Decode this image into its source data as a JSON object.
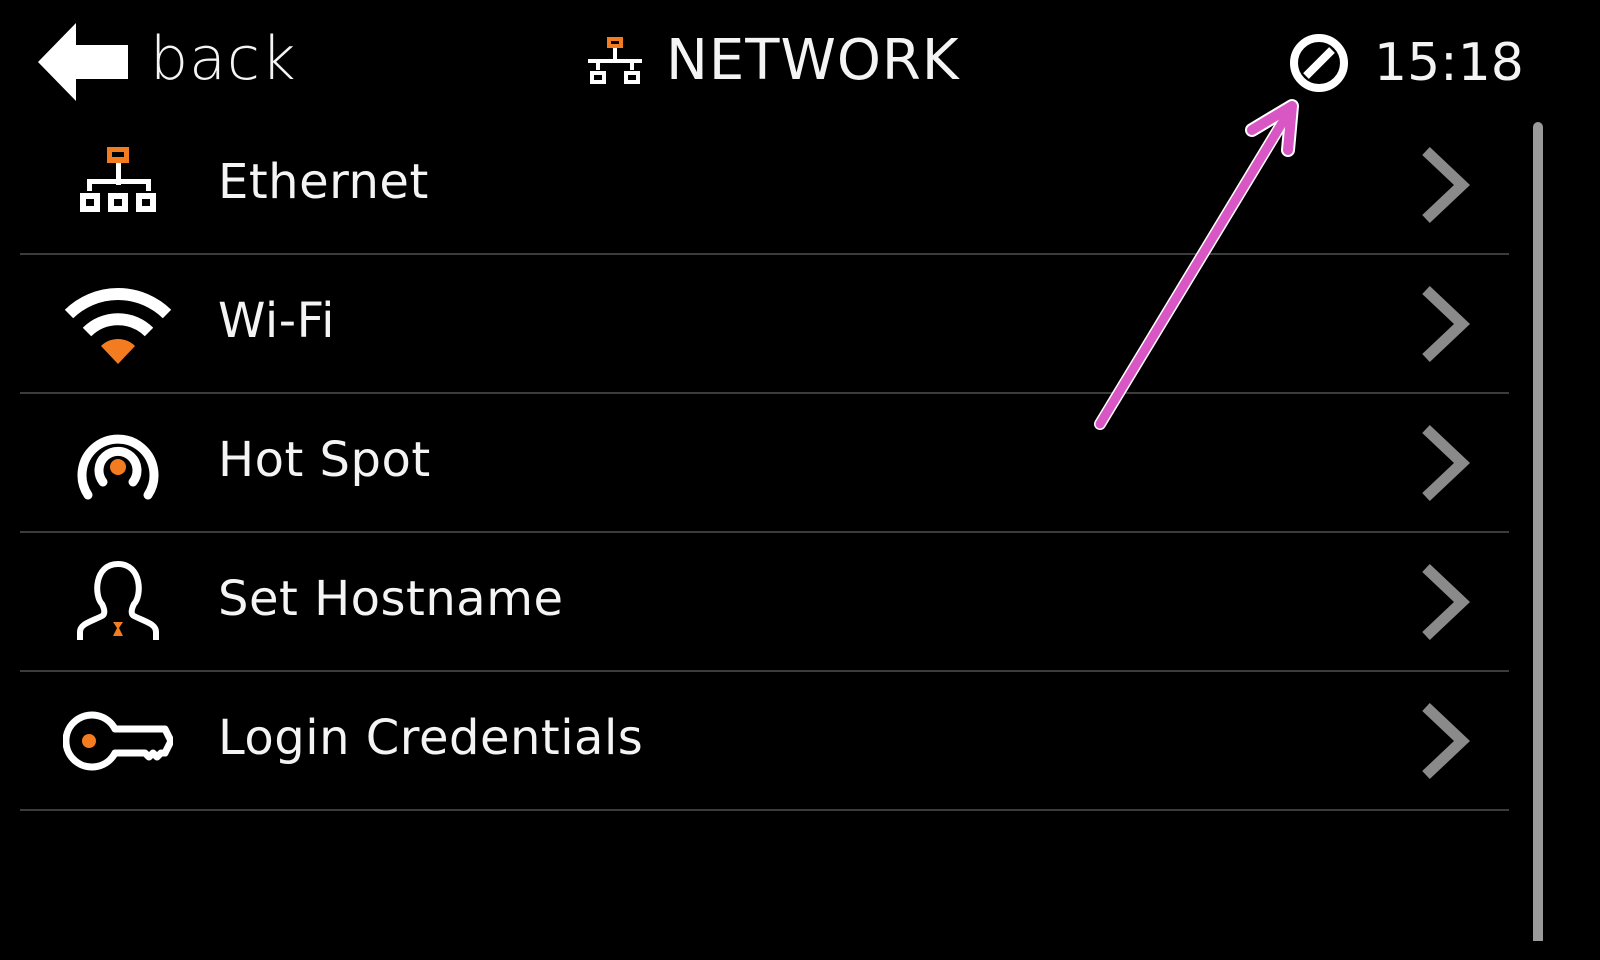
{
  "header": {
    "back_label": "back",
    "back_icon": "arrow-left-icon",
    "title": "NETWORK",
    "title_icon": "network-icon",
    "status_icon": "no-connection-icon",
    "clock": "15:18"
  },
  "menu": {
    "items": [
      {
        "label": "Ethernet",
        "icon": "ethernet-icon"
      },
      {
        "label": "Wi-Fi",
        "icon": "wifi-icon"
      },
      {
        "label": "Hot Spot",
        "icon": "hotspot-icon"
      },
      {
        "label": "Set Hostname",
        "icon": "user-icon"
      },
      {
        "label": "Login Credentials",
        "icon": "key-icon"
      }
    ],
    "chevron_icon": "chevron-right-icon"
  },
  "colors": {
    "background": "#000000",
    "text": "#f4f4f4",
    "accent": "#f47c20",
    "chevron": "#8a8a8a",
    "divider": "#3c3c3c",
    "annotation_arrow": "#d957c4"
  },
  "annotation": {
    "type": "arrow",
    "points_to": "no-connection-icon"
  }
}
